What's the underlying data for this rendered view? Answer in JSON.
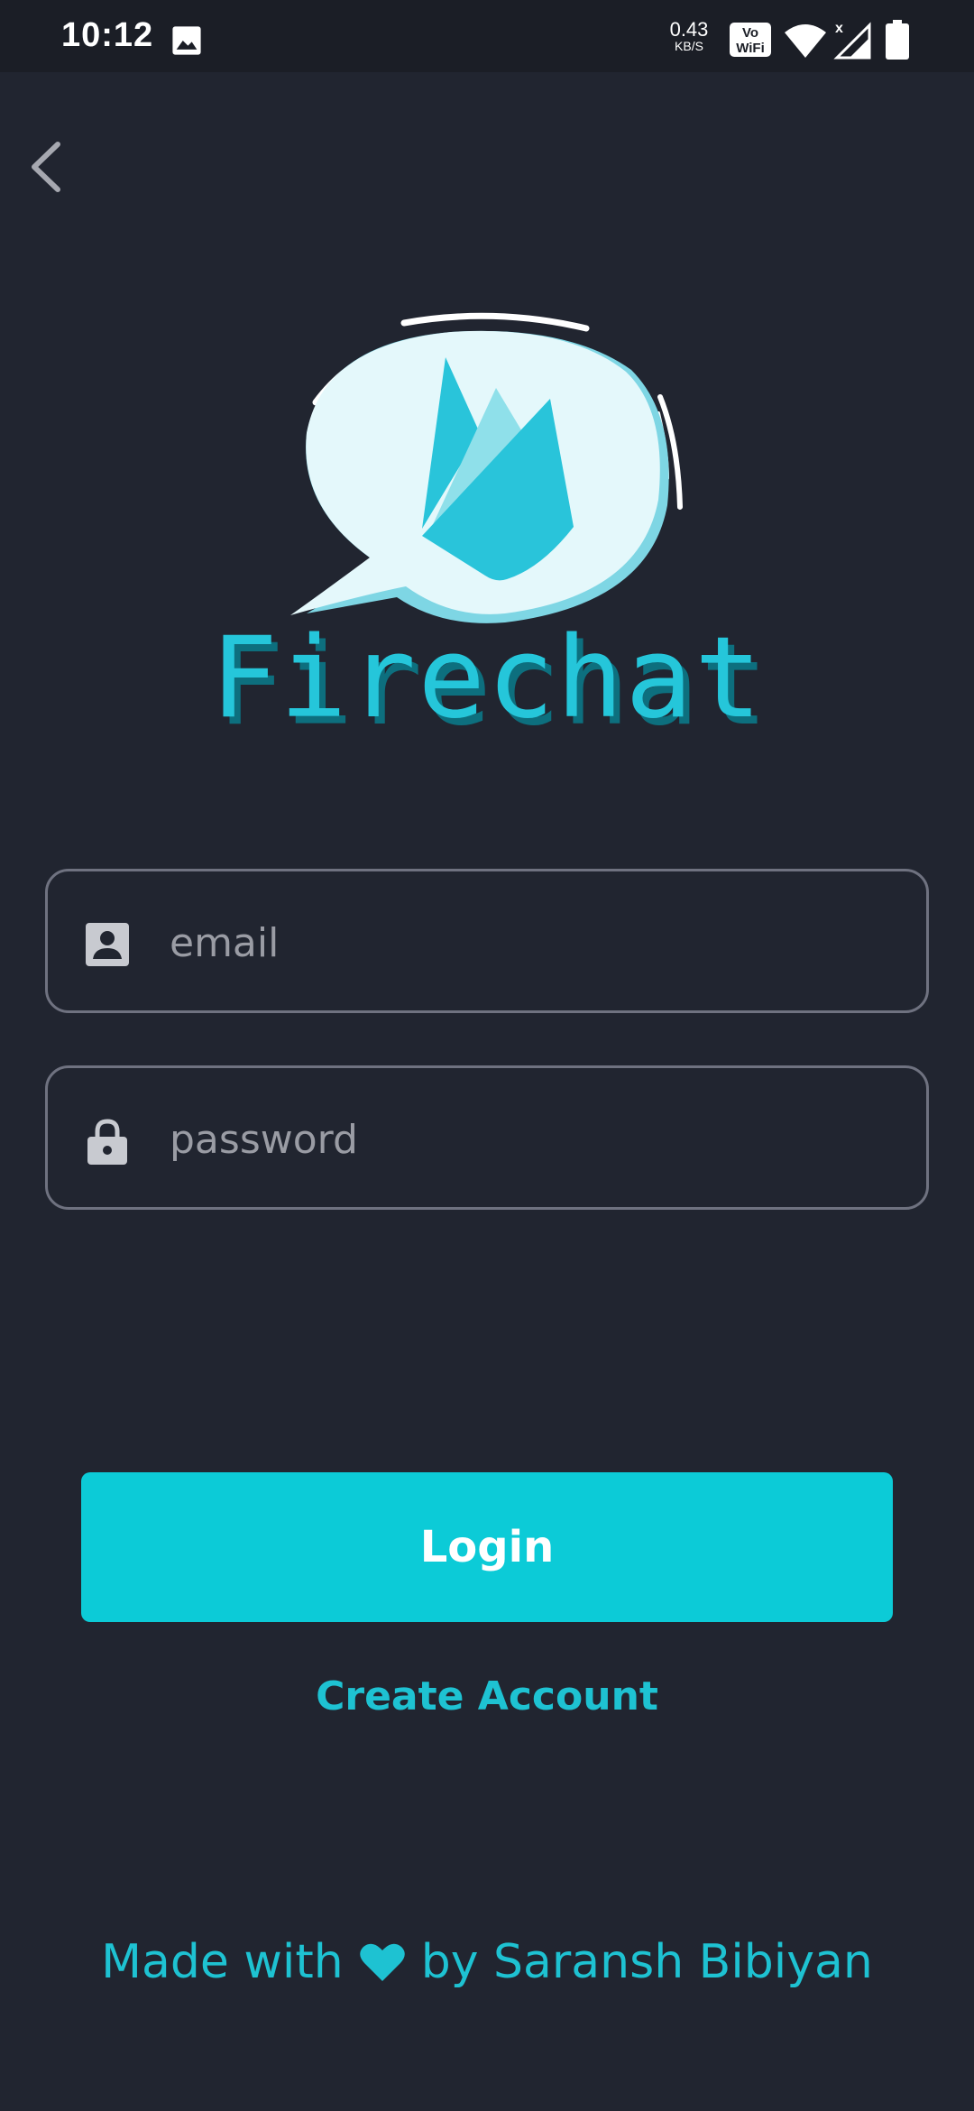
{
  "status_bar": {
    "time": "10:12",
    "network_speed_value": "0.43",
    "network_speed_unit": "KB/S",
    "icons": [
      "gallery-icon",
      "vowifi-icon",
      "wifi-icon",
      "signal-icon",
      "battery-icon"
    ]
  },
  "header": {
    "back_icon": "chevron-left-icon"
  },
  "logo": {
    "wordmark": "Firechat"
  },
  "form": {
    "email": {
      "placeholder": "email",
      "value": "",
      "icon": "contact-card-icon"
    },
    "password": {
      "placeholder": "password",
      "value": "",
      "icon": "lock-icon"
    }
  },
  "actions": {
    "login_label": "Login",
    "create_account_label": "Create Account"
  },
  "footer": {
    "made_with": "Made with",
    "by": "by Saransh Bibiyan",
    "icon": "heart-icon"
  },
  "colors": {
    "background": "#212530",
    "accent": "#0ccbd7",
    "field_border": "#6f7280"
  }
}
